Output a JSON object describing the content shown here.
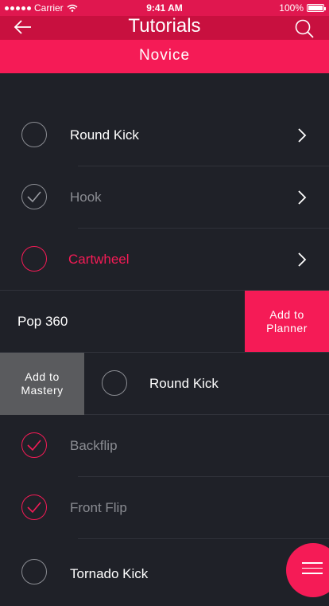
{
  "status": {
    "carrier": "Carrier",
    "time": "9:41 AM",
    "battery": "100%"
  },
  "header": {
    "title": "Tutorials"
  },
  "section": {
    "label": "Novice"
  },
  "rows": [
    {
      "label": "Round Kick",
      "state": "unchecked"
    },
    {
      "label": "Hook",
      "state": "checked"
    },
    {
      "label": "Cartwheel",
      "state": "active"
    },
    {
      "label": "Pop 360",
      "action": "Add to\nPlanner"
    },
    {
      "label": "Round Kick",
      "action": "Add to\nMastery"
    },
    {
      "label": "Backflip",
      "state": "mastered"
    },
    {
      "label": "Front Flip",
      "state": "mastered"
    },
    {
      "label": "Tornado Kick",
      "state": "unchecked"
    }
  ],
  "colors": {
    "accent": "#f51b56",
    "header": "#c8103f",
    "background": "#1f2128",
    "muted": "#8a8c92"
  },
  "icons": {
    "back": "arrow-left-icon",
    "search": "search-icon",
    "chevron": "chevron-right-icon",
    "menu": "menu-icon"
  }
}
